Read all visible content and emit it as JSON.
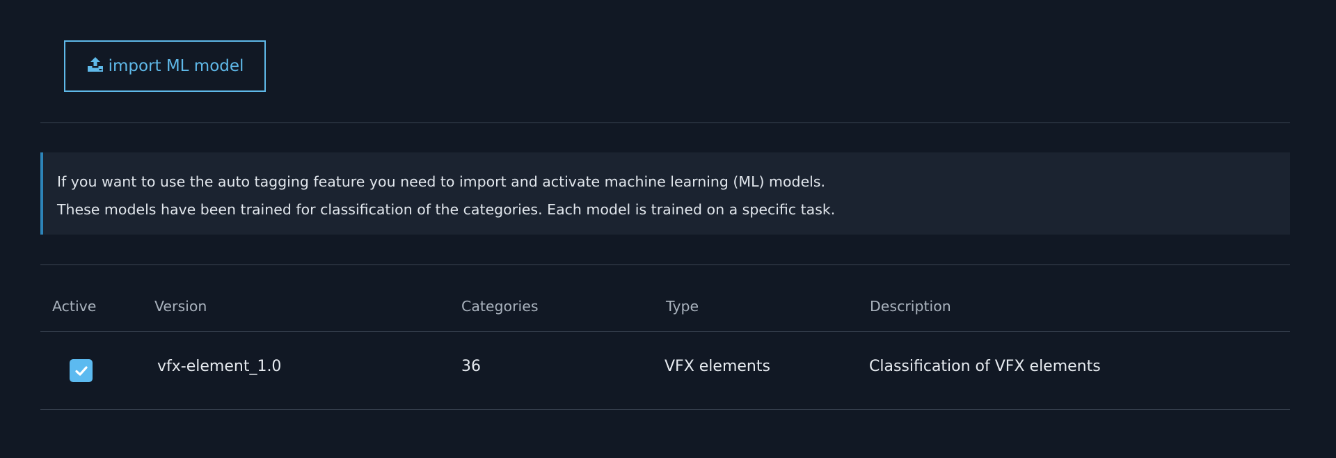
{
  "toolbar": {
    "import_label": "import ML model",
    "import_icon": "upload-icon",
    "accent_color": "#5fb9e9"
  },
  "info": {
    "line1": "If you want to use the auto tagging feature you need to import and activate machine learning (ML) models.",
    "line2": "These models have been trained for classification of the categories. Each model is trained on a specific task."
  },
  "table": {
    "columns": [
      "Active",
      "Version",
      "Categories",
      "Type",
      "Description"
    ],
    "rows": [
      {
        "active": true,
        "version": "vfx-element_1.0",
        "categories": "36",
        "type": "VFX elements",
        "description": "Classification of VFX elements"
      }
    ]
  }
}
